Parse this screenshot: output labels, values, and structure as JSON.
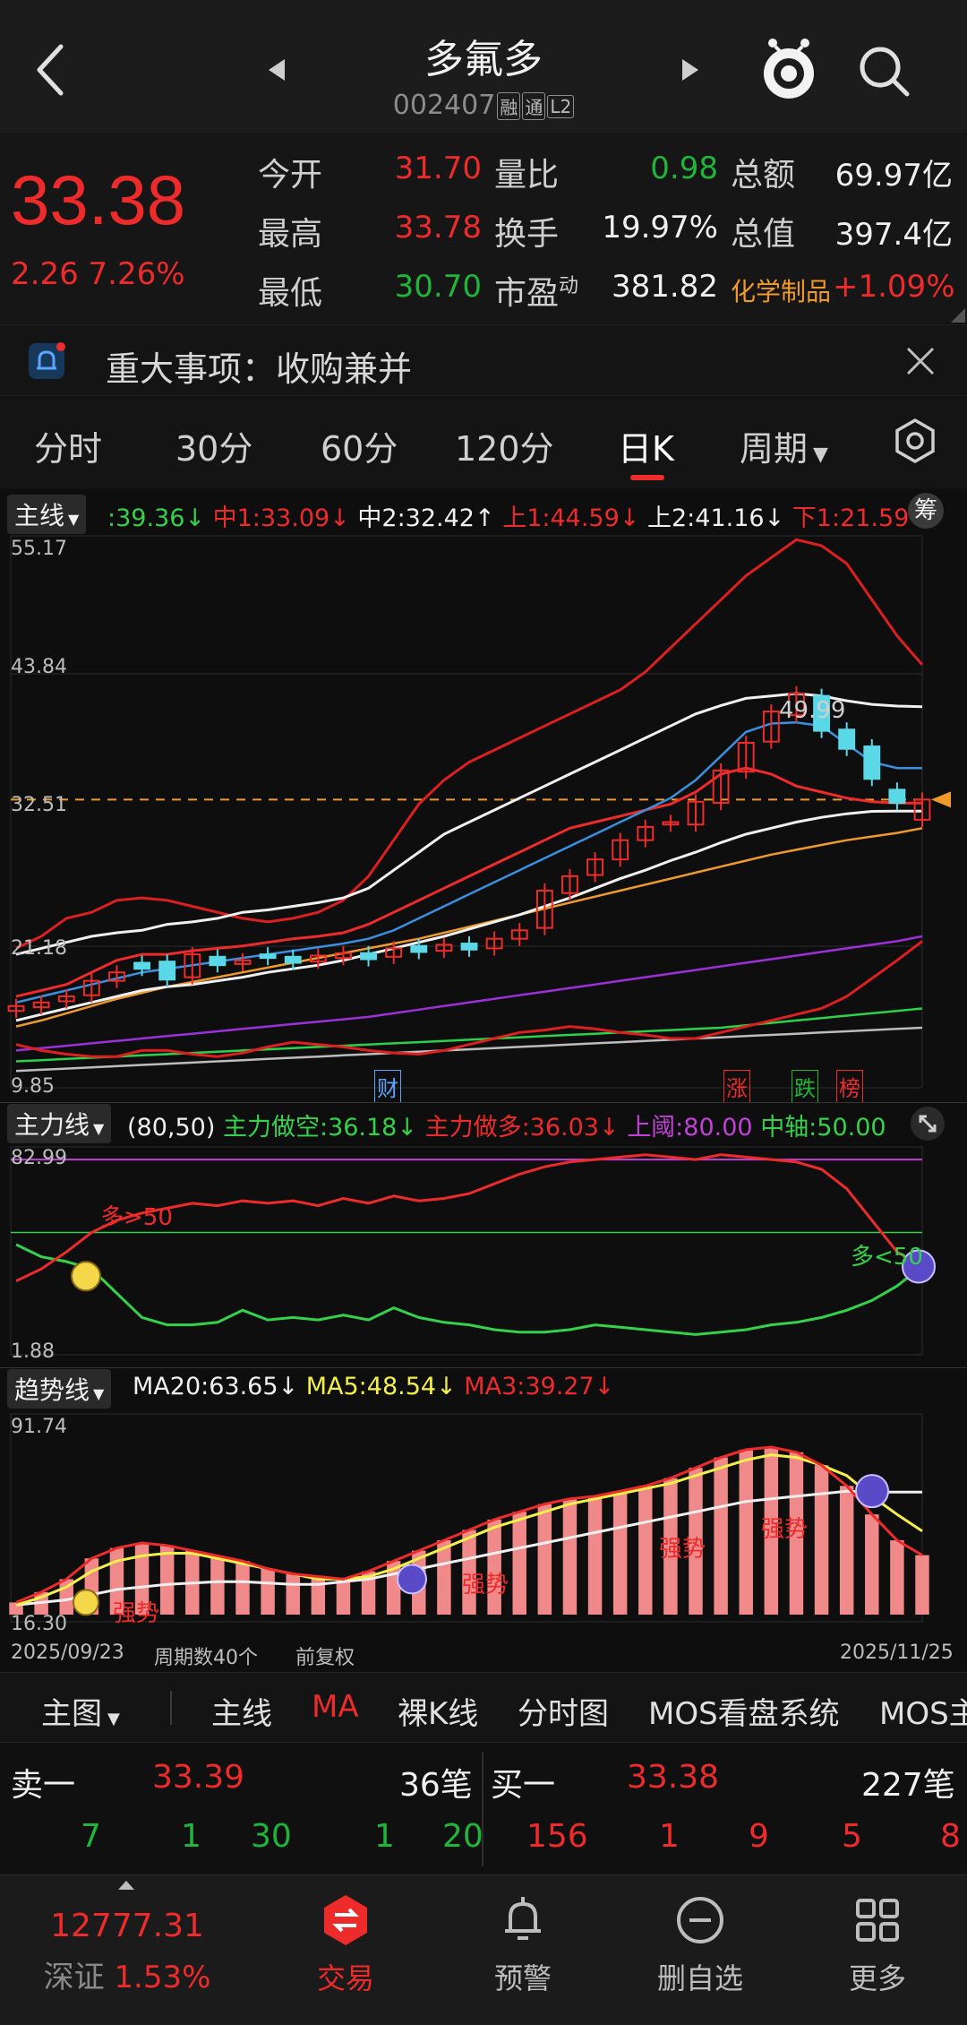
{
  "header": {
    "title": "多氟多",
    "code": "002407",
    "badges": [
      "融",
      "通",
      "L2"
    ]
  },
  "quote": {
    "price": "33.38",
    "change": "2.26",
    "change_pct": "7.26%",
    "rows": [
      {
        "l1": "今开",
        "v1": "31.70",
        "c1": "red",
        "l2": "量比",
        "v2": "0.98",
        "c2": "green",
        "l3": "总额",
        "v3": "69.97亿",
        "c3": "white"
      },
      {
        "l1": "最高",
        "v1": "33.78",
        "c1": "red",
        "l2": "换手",
        "v2": "19.97%",
        "c2": "white",
        "l3": "总值",
        "v3": "397.4亿",
        "c3": "white"
      },
      {
        "l1": "最低",
        "v1": "30.70",
        "c1": "green",
        "l2": "市盈",
        "v2": "381.82",
        "c2": "white",
        "l3": "化学制品",
        "v3": "+1.09%",
        "c3": "red"
      }
    ],
    "pe_sup": "动"
  },
  "notice": {
    "text": "重大事项：收购兼并"
  },
  "tabs": [
    "分时",
    "30分",
    "60分",
    "120分",
    "日K",
    "周期"
  ],
  "active_tab": "日K",
  "main_panel": {
    "label": "主线",
    "chip": "筹",
    "legend": [
      {
        "text": ":39.36↓",
        "color": "#33d24a"
      },
      {
        "text": "中1:33.09↓",
        "color": "#ee2b2b"
      },
      {
        "text": "中2:32.42↑",
        "color": "#f0f0f0"
      },
      {
        "text": "上1:44.59↓",
        "color": "#ee2b2b"
      },
      {
        "text": "上2:41.16↓",
        "color": "#f0f0f0"
      },
      {
        "text": "下1:21.59↑",
        "color": "#ee2b2b"
      }
    ],
    "axis": [
      "55.17",
      "43.84",
      "32.51",
      "21.18",
      "9.85"
    ],
    "peak_label": "49.99",
    "events": [
      "财",
      "涨",
      "跌",
      "榜"
    ]
  },
  "power_panel": {
    "label": "主力线",
    "legend": [
      {
        "text": "(80,50)",
        "color": "#f0f0f0"
      },
      {
        "text": "主力做空:36.18↓",
        "color": "#33d24a"
      },
      {
        "text": "主力做多:36.03↓",
        "color": "#ee2b2b"
      },
      {
        "text": "上阈:80.00",
        "color": "#c040d8"
      },
      {
        "text": "中轴:50.00",
        "color": "#33d24a"
      }
    ],
    "axis": [
      "82.99",
      "1.88"
    ],
    "annot_left": "多>50",
    "annot_right": "多<50"
  },
  "trend_panel": {
    "label": "趋势线",
    "legend": [
      {
        "text": "MA20:63.65↓",
        "color": "#f0f0f0"
      },
      {
        "text": "MA5:48.54↓",
        "color": "#f4f04a"
      },
      {
        "text": "MA3:39.27↓",
        "color": "#ee2b2b"
      }
    ],
    "axis": [
      "91.74",
      "16.30"
    ],
    "annot": "强势"
  },
  "date_bar": {
    "start": "2025/09/23",
    "period": "周期数40个",
    "adjust": "前复权",
    "end": "2025/11/25"
  },
  "indicator_tabs": [
    "主图",
    "主线",
    "MA",
    "裸K线",
    "分时图",
    "MOS看盘系统",
    "MOS主"
  ],
  "order_book": {
    "sell_label": "卖一",
    "sell_price": "33.39",
    "sell_count": "36笔",
    "buy_label": "买一",
    "buy_price": "33.38",
    "buy_count": "227笔",
    "sell_ticks": [
      "7",
      "1",
      "30",
      "1",
      "20"
    ],
    "buy_ticks": [
      "156",
      "1",
      "9",
      "5",
      "8"
    ]
  },
  "nav": {
    "index_value": "12777.31",
    "index_name": "深证",
    "index_pct": "1.53%",
    "items": [
      "交易",
      "预警",
      "删自选",
      "更多"
    ]
  },
  "chart_data": [
    {
      "type": "line",
      "title": "主线",
      "x_range": [
        "2025/09/23",
        "2025/11/25"
      ],
      "ylim": [
        9.85,
        55.17
      ],
      "series": [
        {
          "name": "上1",
          "values": [
            21,
            22,
            23.5,
            24,
            25,
            25.2,
            25,
            24.5,
            24,
            23.5,
            23.2,
            23.5,
            24,
            25,
            27,
            30,
            33,
            35,
            36.5,
            37.5,
            38.5,
            39.5,
            40.5,
            41.5,
            42.5,
            44,
            46,
            48,
            50,
            52,
            53.5,
            55,
            54.5,
            53,
            50,
            47,
            44.59
          ]
        },
        {
          "name": "上2",
          "values": [
            20.5,
            21,
            21.5,
            22,
            22.3,
            22.5,
            23,
            23.2,
            23.5,
            24,
            24.2,
            24.5,
            24.8,
            25.2,
            26,
            27.5,
            29,
            30.5,
            31.5,
            32.5,
            33.5,
            34.5,
            35.5,
            36.5,
            37.5,
            38.5,
            39.5,
            40.5,
            41.2,
            41.8,
            42,
            42.2,
            42,
            41.6,
            41.3,
            41.16,
            41.1
          ]
        },
        {
          "name": "中1",
          "values": [
            17,
            17.5,
            18,
            19,
            20,
            20.5,
            20.5,
            20.8,
            21,
            21.2,
            21.5,
            21.8,
            22,
            22.3,
            23,
            24,
            25,
            26,
            27,
            28,
            29,
            30,
            31,
            31.5,
            32,
            32.5,
            33,
            34,
            35.5,
            36,
            35.5,
            34.5,
            34,
            33.5,
            33.2,
            33.09,
            33.09
          ]
        },
        {
          "name": "中2",
          "values": [
            15,
            15.5,
            16,
            16.5,
            17,
            17.5,
            17.8,
            18,
            18.3,
            18.6,
            19,
            19.3,
            19.6,
            20,
            20.5,
            21,
            21.5,
            22,
            22.6,
            23.2,
            23.8,
            24.5,
            25.2,
            26,
            26.8,
            27.5,
            28.3,
            29,
            29.8,
            30.5,
            31,
            31.5,
            31.9,
            32.2,
            32.4,
            32.42,
            32.42
          ]
        },
        {
          "name": "下1",
          "values": [
            13,
            12.5,
            12.2,
            12,
            12,
            12.5,
            12.5,
            12.2,
            12,
            12.3,
            12.8,
            13.2,
            13,
            12.8,
            12.5,
            12.3,
            12.2,
            12.5,
            13,
            13.5,
            14,
            14.2,
            14.5,
            14.3,
            14,
            13.8,
            13.5,
            13.5,
            14,
            14.5,
            15,
            15.5,
            16,
            17,
            18.5,
            20,
            21.59
          ]
        }
      ]
    },
    {
      "type": "line",
      "title": "主力线",
      "ylim": [
        1.88,
        82.99
      ],
      "series": [
        {
          "name": "主力做空",
          "values": [
            45,
            40,
            38,
            35,
            25,
            15,
            12,
            12,
            13,
            18,
            14,
            15,
            14,
            16,
            14,
            19,
            15,
            13,
            12,
            10,
            9,
            9,
            10,
            12,
            11,
            10,
            9,
            8,
            9,
            10,
            12,
            13,
            15,
            18,
            22,
            28,
            36.18
          ]
        },
        {
          "name": "主力做多",
          "values": [
            30,
            35,
            42,
            50,
            55,
            58,
            60,
            62,
            61,
            63,
            62,
            63,
            61,
            64,
            62,
            65,
            63,
            64,
            66,
            70,
            74,
            77,
            79,
            80,
            81,
            82,
            81,
            80,
            82,
            81,
            80,
            79,
            76,
            68,
            55,
            42,
            36.03
          ]
        },
        {
          "name": "上阈",
          "values": [
            80,
            80
          ]
        },
        {
          "name": "中轴",
          "values": [
            50,
            50
          ]
        }
      ]
    },
    {
      "type": "bar",
      "title": "趋势线",
      "ylim": [
        16.3,
        91.74
      ],
      "series": [
        {
          "name": "MA20",
          "values": [
            20,
            21,
            22,
            24,
            26,
            27,
            28,
            28.5,
            29,
            29,
            28.5,
            28,
            28,
            29,
            30,
            32,
            34,
            36,
            38,
            40,
            42,
            44,
            46,
            48,
            50,
            52,
            54,
            56,
            58,
            60,
            61,
            62,
            63,
            64,
            63.65,
            63.65,
            63.65
          ]
        },
        {
          "name": "MA5",
          "values": [
            20,
            23,
            27,
            33,
            37,
            39,
            40,
            40,
            38,
            36,
            34,
            32,
            30,
            30,
            31,
            34,
            38,
            42,
            46,
            50,
            53,
            56,
            59,
            61,
            63,
            65,
            67,
            70,
            73,
            76,
            78,
            77,
            74,
            70,
            62,
            55,
            48.54
          ]
        },
        {
          "name": "MA3",
          "values": [
            21,
            25,
            30,
            38,
            42,
            44,
            43,
            41,
            39,
            37,
            34,
            32,
            31,
            30,
            33,
            37,
            41,
            45,
            49,
            53,
            56,
            59,
            61,
            62,
            64,
            66,
            69,
            73,
            77,
            80,
            81,
            79,
            74,
            66,
            55,
            45,
            39.27
          ]
        }
      ]
    }
  ]
}
